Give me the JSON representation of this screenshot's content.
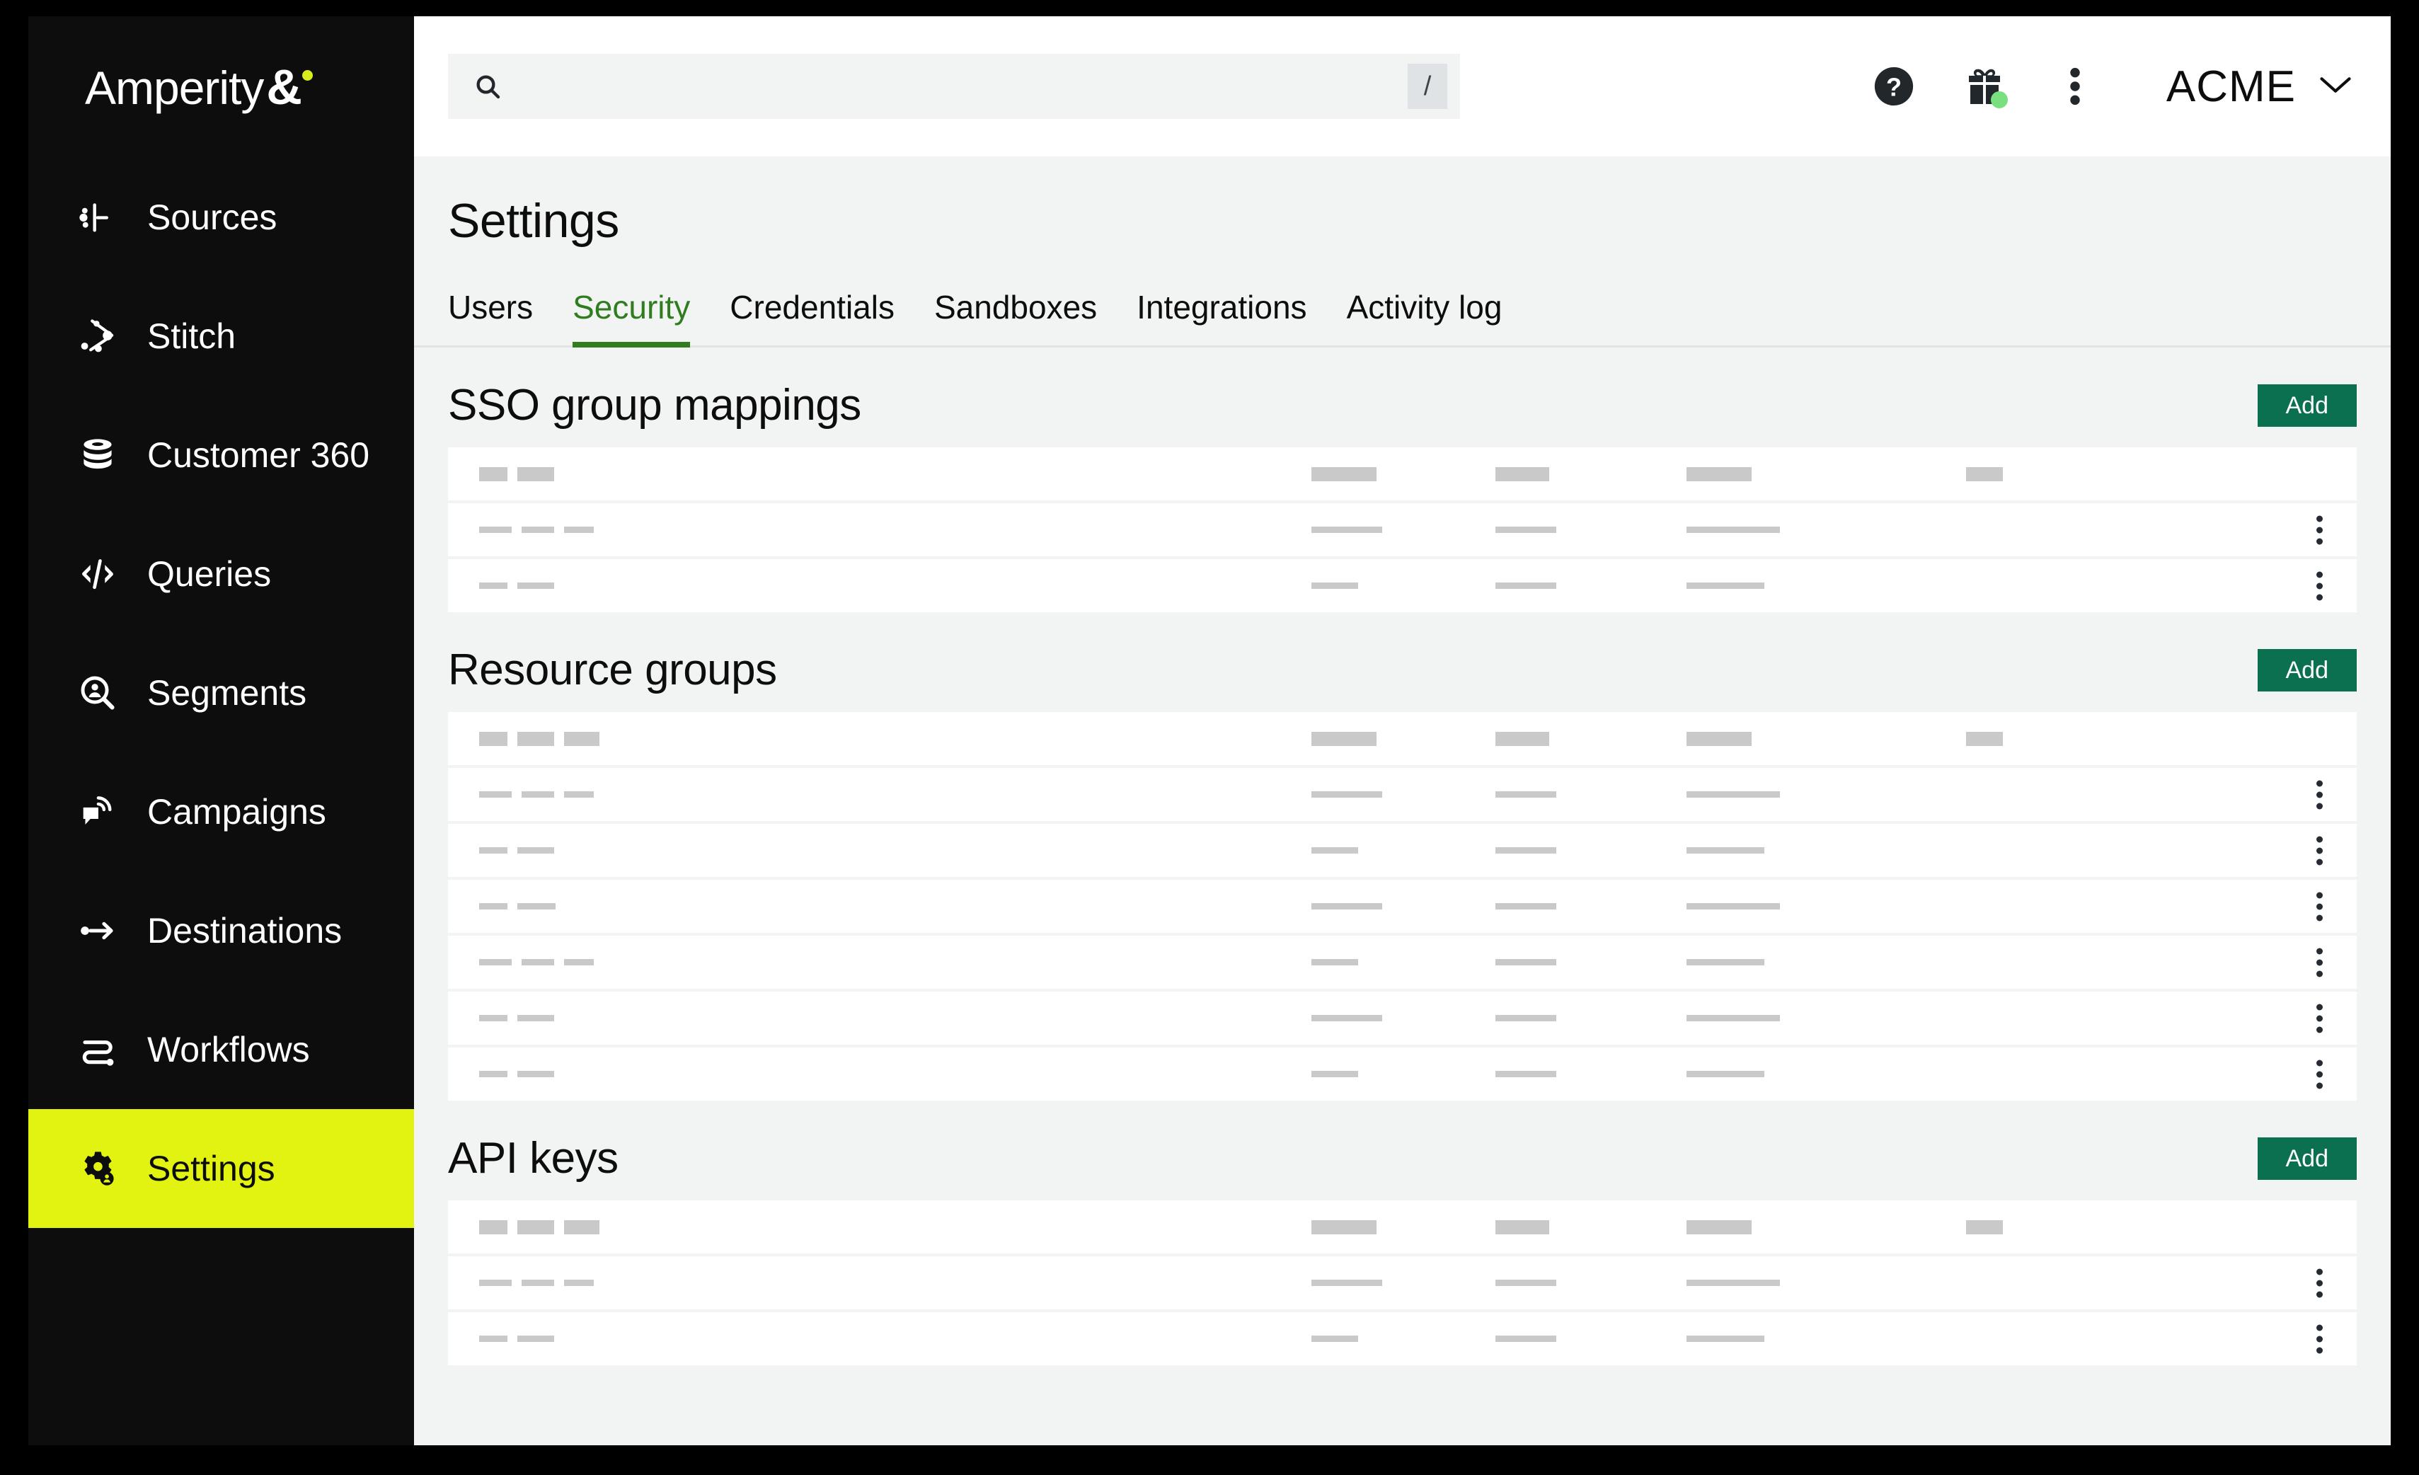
{
  "brand": {
    "name": "Amperity",
    "mark": "&"
  },
  "sidebar": {
    "items": [
      {
        "label": "Sources",
        "icon": "sources-icon",
        "active": false
      },
      {
        "label": "Stitch",
        "icon": "stitch-icon",
        "active": false
      },
      {
        "label": "Customer 360",
        "icon": "database-icon",
        "active": false
      },
      {
        "label": "Queries",
        "icon": "code-icon",
        "active": false
      },
      {
        "label": "Segments",
        "icon": "segment-search-icon",
        "active": false
      },
      {
        "label": "Campaigns",
        "icon": "campaigns-icon",
        "active": false
      },
      {
        "label": "Destinations",
        "icon": "destinations-icon",
        "active": false
      },
      {
        "label": "Workflows",
        "icon": "workflows-icon",
        "active": false
      },
      {
        "label": "Settings",
        "icon": "settings-gear-icon",
        "active": true
      }
    ]
  },
  "topbar": {
    "search": {
      "value": "",
      "placeholder": "",
      "shortcut": "/",
      "icon": "search-icon"
    },
    "help_icon": "help-circle-icon",
    "gift_icon": "gift-icon",
    "more_icon": "kebab-menu-icon",
    "account": {
      "name": "ACME",
      "chevron": "chevron-down-icon"
    },
    "notification_color": "#79e07f"
  },
  "page": {
    "title": "Settings",
    "tabs": [
      {
        "label": "Users",
        "active": false
      },
      {
        "label": "Security",
        "active": true
      },
      {
        "label": "Credentials",
        "active": false
      },
      {
        "label": "Sandboxes",
        "active": false
      },
      {
        "label": "Integrations",
        "active": false
      },
      {
        "label": "Activity log",
        "active": false
      }
    ],
    "active_tab_color": "#2f7d1f"
  },
  "sections": [
    {
      "title": "SSO group mappings",
      "add_label": "Add",
      "header_row": {
        "name_bars": [
          40,
          52
        ],
        "col_bars": [
          92,
          76,
          92,
          52
        ]
      },
      "rows": [
        {
          "name_bars": [
            46,
            46,
            42
          ],
          "col_bars": [
            100,
            86,
            132
          ]
        },
        {
          "name_bars": [
            40,
            52
          ],
          "col_bars": [
            66,
            86,
            110
          ]
        }
      ]
    },
    {
      "title": "Resource groups",
      "add_label": "Add",
      "header_row": {
        "name_bars": [
          40,
          52,
          50
        ],
        "col_bars": [
          92,
          76,
          92,
          52
        ]
      },
      "rows": [
        {
          "name_bars": [
            46,
            46,
            42
          ],
          "col_bars": [
            100,
            86,
            132
          ]
        },
        {
          "name_bars": [
            40,
            52
          ],
          "col_bars": [
            66,
            86,
            110
          ]
        },
        {
          "name_bars": [
            40,
            54
          ],
          "col_bars": [
            100,
            86,
            132
          ]
        },
        {
          "name_bars": [
            46,
            46,
            42
          ],
          "col_bars": [
            66,
            86,
            110
          ]
        },
        {
          "name_bars": [
            40,
            52
          ],
          "col_bars": [
            100,
            86,
            132
          ]
        },
        {
          "name_bars": [
            40,
            52
          ],
          "col_bars": [
            66,
            86,
            110
          ]
        }
      ]
    },
    {
      "title": "API keys",
      "add_label": "Add",
      "header_row": {
        "name_bars": [
          40,
          52,
          50
        ],
        "col_bars": [
          92,
          76,
          92,
          52
        ]
      },
      "rows": [
        {
          "name_bars": [
            46,
            46,
            42
          ],
          "col_bars": [
            100,
            86,
            132
          ]
        },
        {
          "name_bars": [
            40,
            52
          ],
          "col_bars": [
            66,
            86,
            110
          ]
        }
      ]
    }
  ],
  "colors": {
    "sidebar_bg": "#0d0d0d",
    "active_nav": "#e2f211",
    "add_button": "#0a7050",
    "content_bg": "#f2f3f3",
    "skeleton": "#c9c9c9"
  }
}
